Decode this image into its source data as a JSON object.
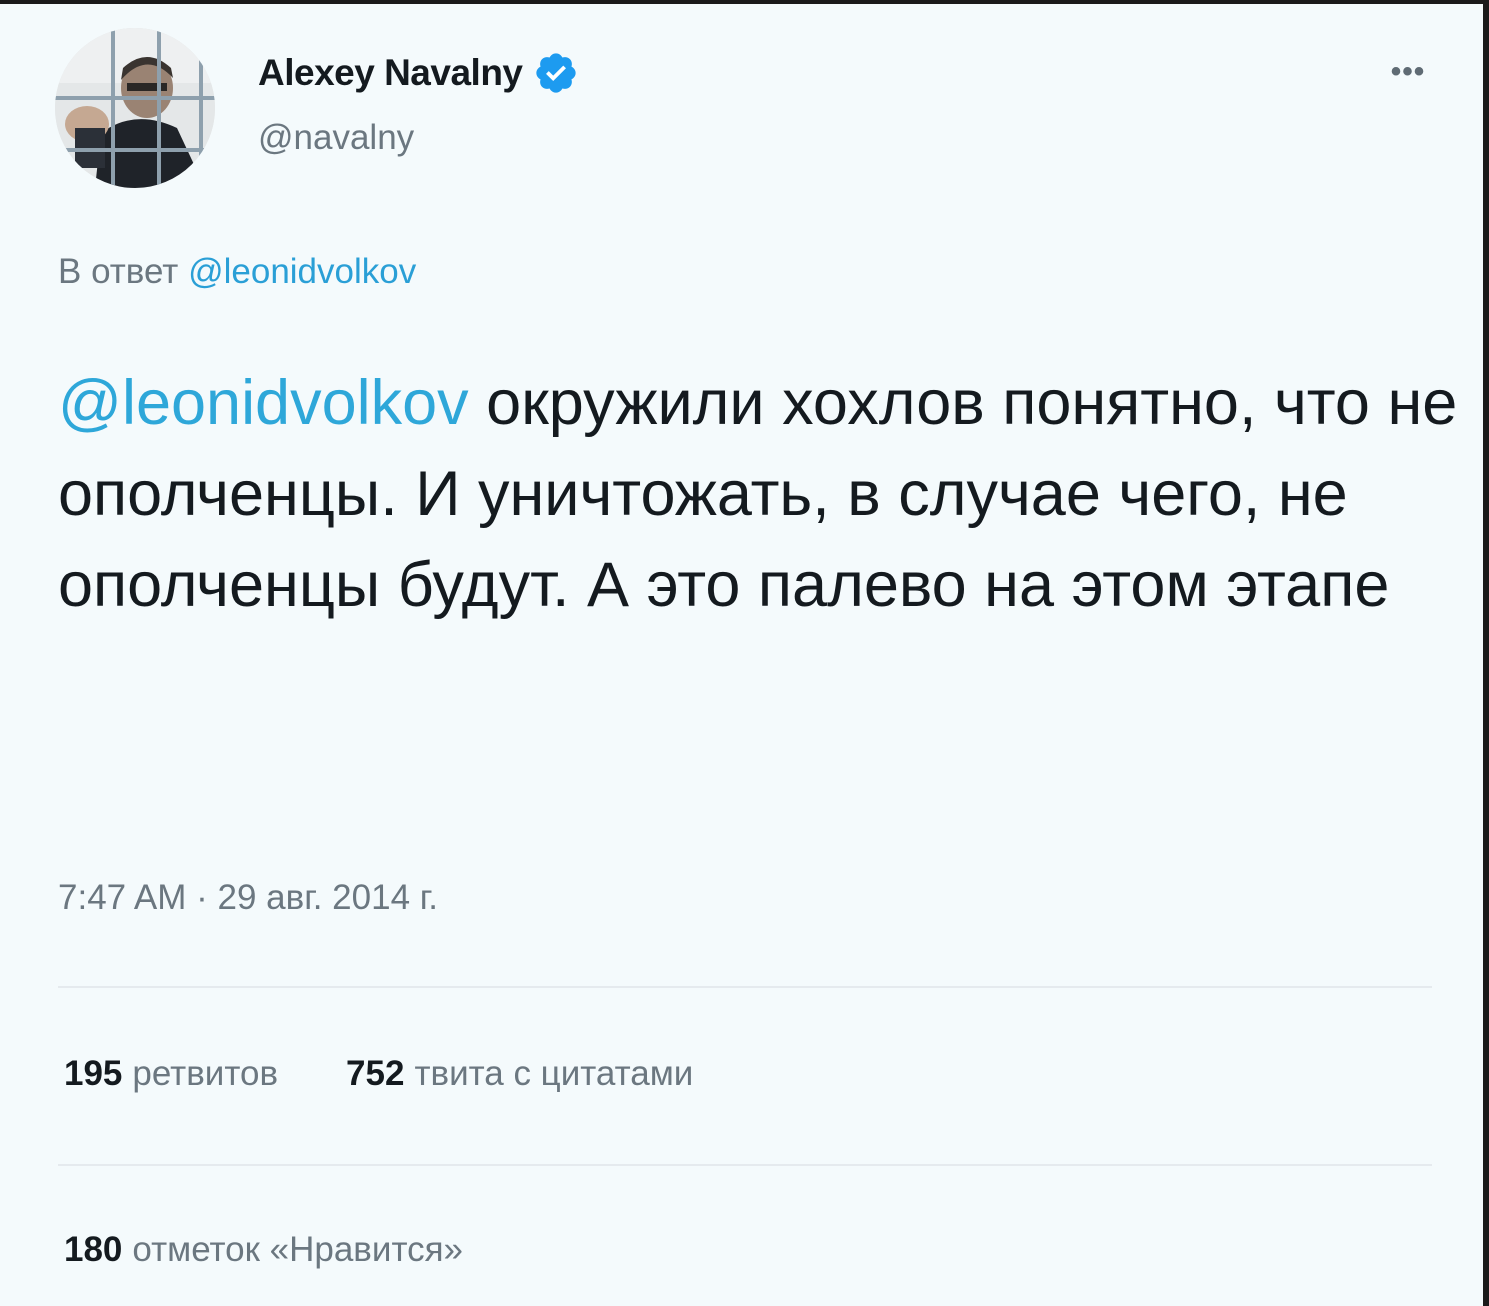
{
  "author": {
    "display_name": "Alexey Navalny",
    "handle": "@navalny",
    "verified": true,
    "verified_color": "#1d9bf0"
  },
  "more_label": "•••",
  "reply": {
    "prefix": "В ответ",
    "mention": "@leonidvolkov"
  },
  "tweet": {
    "mention": "@leonidvolkov",
    "text": " окружили хохлов понятно, что не ополченцы. И уничтожать, в случае чего, не ополченцы будут. А это палево на этом этапе",
    "mention_color": "#2ea7d9"
  },
  "timestamp": "7:47 AM · 29 авг. 2014 г.",
  "stats": {
    "retweets_count": "195",
    "retweets_label": "ретвитов",
    "quotes_count": "752",
    "quotes_label": "твита с цитатами",
    "likes_count": "180",
    "likes_label": "отметок «Нравится»"
  },
  "icons": {
    "avatar": "profile-photo",
    "verified": "verified-badge-icon",
    "more": "more-horizontal-icon"
  }
}
